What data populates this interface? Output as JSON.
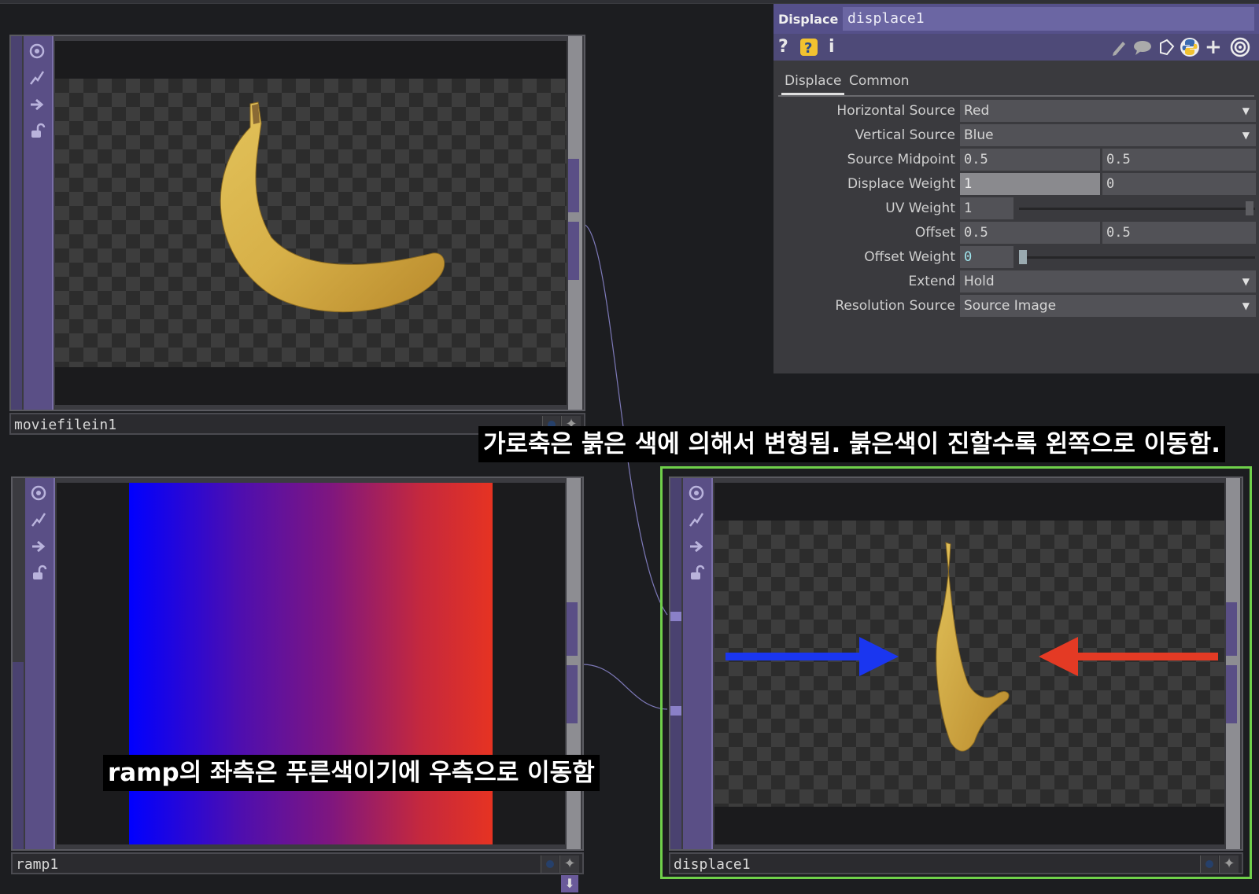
{
  "parameters": {
    "op_type": "Displace",
    "op_name": "displace1",
    "tabs": [
      "Displace",
      "Common"
    ],
    "rows": {
      "horizontal_source": {
        "label": "Horizontal Source",
        "value": "Red"
      },
      "vertical_source": {
        "label": "Vertical Source",
        "value": "Blue"
      },
      "source_midpoint": {
        "label": "Source Midpoint",
        "value1": "0.5",
        "value2": "0.5"
      },
      "displace_weight": {
        "label": "Displace Weight",
        "value1": "1",
        "value2": "0"
      },
      "uv_weight": {
        "label": "UV Weight",
        "value": "1",
        "level": 1.0
      },
      "offset": {
        "label": "Offset",
        "value1": "0.5",
        "value2": "0.5"
      },
      "offset_weight": {
        "label": "Offset Weight",
        "value": "0",
        "level": 0.0
      },
      "extend": {
        "label": "Extend",
        "value": "Hold"
      },
      "resolution_source": {
        "label": "Resolution Source",
        "value": "Source Image"
      }
    },
    "toolbar_icons": [
      "help-icon",
      "python-help-icon",
      "info-icon",
      "edit-icon",
      "comment-icon",
      "clone-icon",
      "python-icon",
      "add-icon",
      "target-icon"
    ]
  },
  "nodes": {
    "moviefilein": {
      "name": "moviefilein1"
    },
    "ramp": {
      "name": "ramp1"
    },
    "displace": {
      "name": "displace1"
    }
  },
  "captions": {
    "top": "가로축은 붉은 색에 의해서 변형됨. 붉은색이 진할수록 왼쪽으로 이동함.",
    "bottom": "ramp의 좌측은 푸른색이기에 우측으로 이동함"
  },
  "colors": {
    "node_bar": "#5a4f86",
    "selected_outline": "#6fd04a",
    "arrow_blue": "#1a36f0",
    "arrow_red": "#e43a24",
    "panel_title": "#55508a"
  }
}
